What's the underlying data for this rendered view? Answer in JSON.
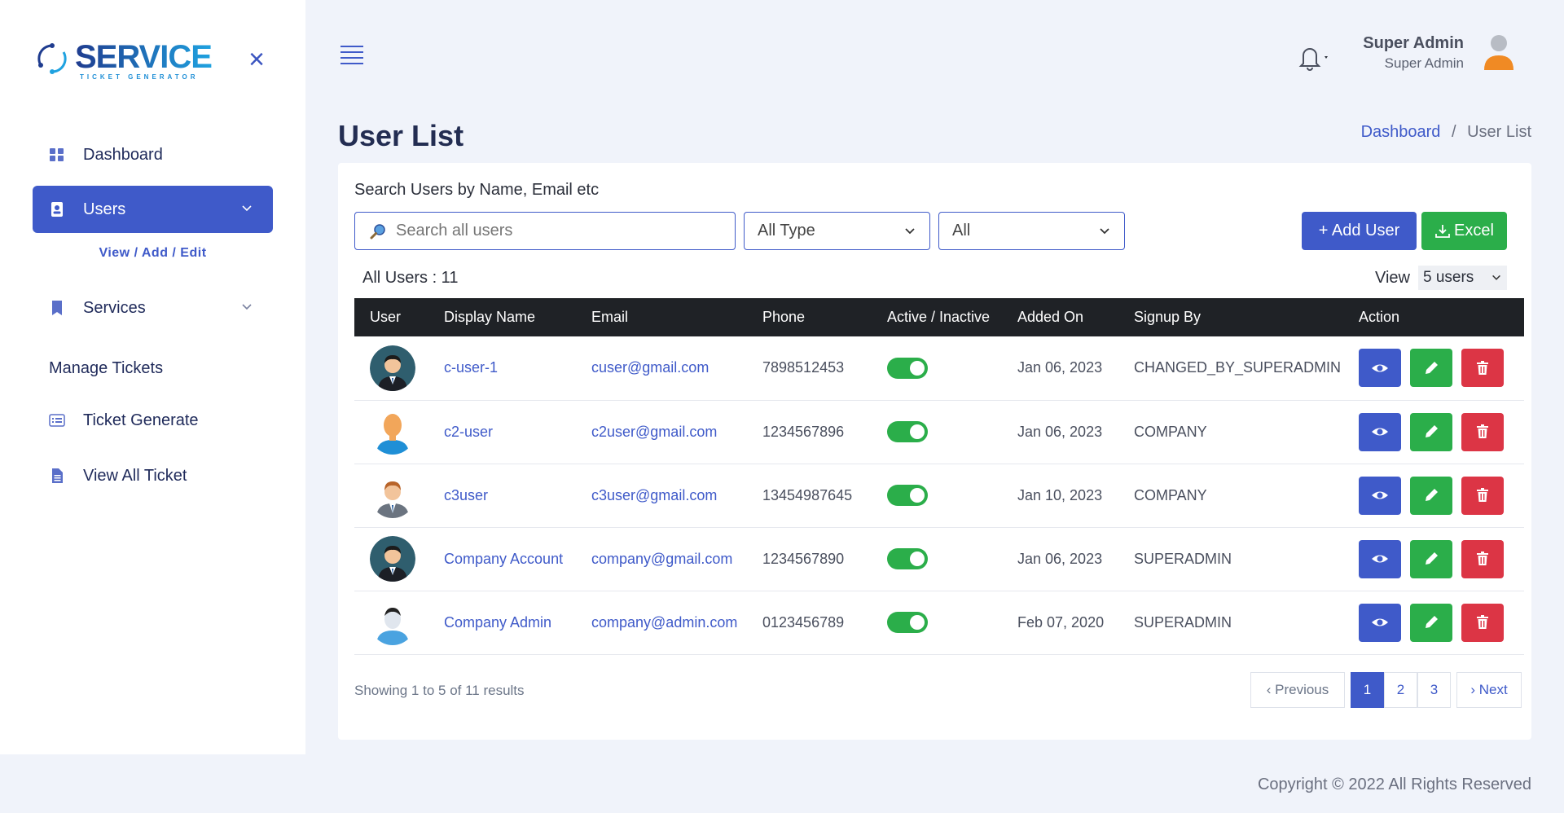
{
  "brand": {
    "name": "SERVICE",
    "tagline": "TICKET GENERATOR"
  },
  "sidebar": {
    "items": [
      {
        "label": "Dashboard"
      },
      {
        "label": "Users"
      },
      {
        "label": "Services"
      },
      {
        "label": "Manage Tickets"
      },
      {
        "label": "Ticket Generate"
      },
      {
        "label": "View All Ticket"
      }
    ],
    "users_sub": "View / Add / Edit"
  },
  "header": {
    "user_name": "Super Admin",
    "user_role": "Super Admin"
  },
  "page": {
    "title": "User List",
    "breadcrumb_home": "Dashboard",
    "breadcrumb_sep": "/",
    "breadcrumb_current": "User List"
  },
  "filters": {
    "search_label": "Search Users by Name, Email etc",
    "search_placeholder": "Search all users",
    "type_select": "All Type",
    "status_select": "All",
    "add_user": "+  Add User",
    "excel": "Excel"
  },
  "summary": {
    "all_users": "All Users : 11",
    "view_label": "View",
    "view_value": "5 users"
  },
  "table": {
    "headers": [
      "User",
      "Display Name",
      "Email",
      "Phone",
      "Active / Inactive",
      "Added On",
      "Signup By",
      "Action"
    ],
    "rows": [
      {
        "name": "c-user-1",
        "email": "cuser@gmail.com",
        "phone": "7898512453",
        "active": true,
        "added": "Jan 06, 2023",
        "signup": "CHANGED_BY_SUPERADMIN",
        "avatar": "man-suit-dark"
      },
      {
        "name": "c2-user",
        "email": "c2user@gmail.com",
        "phone": "1234567896",
        "active": true,
        "added": "Jan 06, 2023",
        "signup": "COMPANY",
        "avatar": "person-orange"
      },
      {
        "name": "c3user",
        "email": "c3user@gmail.com",
        "phone": "13454987645",
        "active": true,
        "added": "Jan 10, 2023",
        "signup": "COMPANY",
        "avatar": "man-suit-gray"
      },
      {
        "name": "Company Account",
        "email": "company@gmail.com",
        "phone": "1234567890",
        "active": true,
        "added": "Jan 06, 2023",
        "signup": "SUPERADMIN",
        "avatar": "man-suit-dark"
      },
      {
        "name": "Company Admin",
        "email": "company@admin.com",
        "phone": "0123456789",
        "active": true,
        "added": "Feb 07, 2020",
        "signup": "SUPERADMIN",
        "avatar": "person-blue"
      }
    ]
  },
  "pagination": {
    "showing": "Showing 1 to 5 of 11 results",
    "prev": "‹ Previous",
    "pages": [
      "1",
      "2",
      "3"
    ],
    "current": "1",
    "next": "› Next"
  },
  "footer": {
    "copyright": "Copyright © 2022 All Rights Reserved"
  },
  "colors": {
    "primary": "#3f5ac9",
    "success": "#2bae4a",
    "danger": "#dc3545",
    "dark": "#1f2226"
  }
}
